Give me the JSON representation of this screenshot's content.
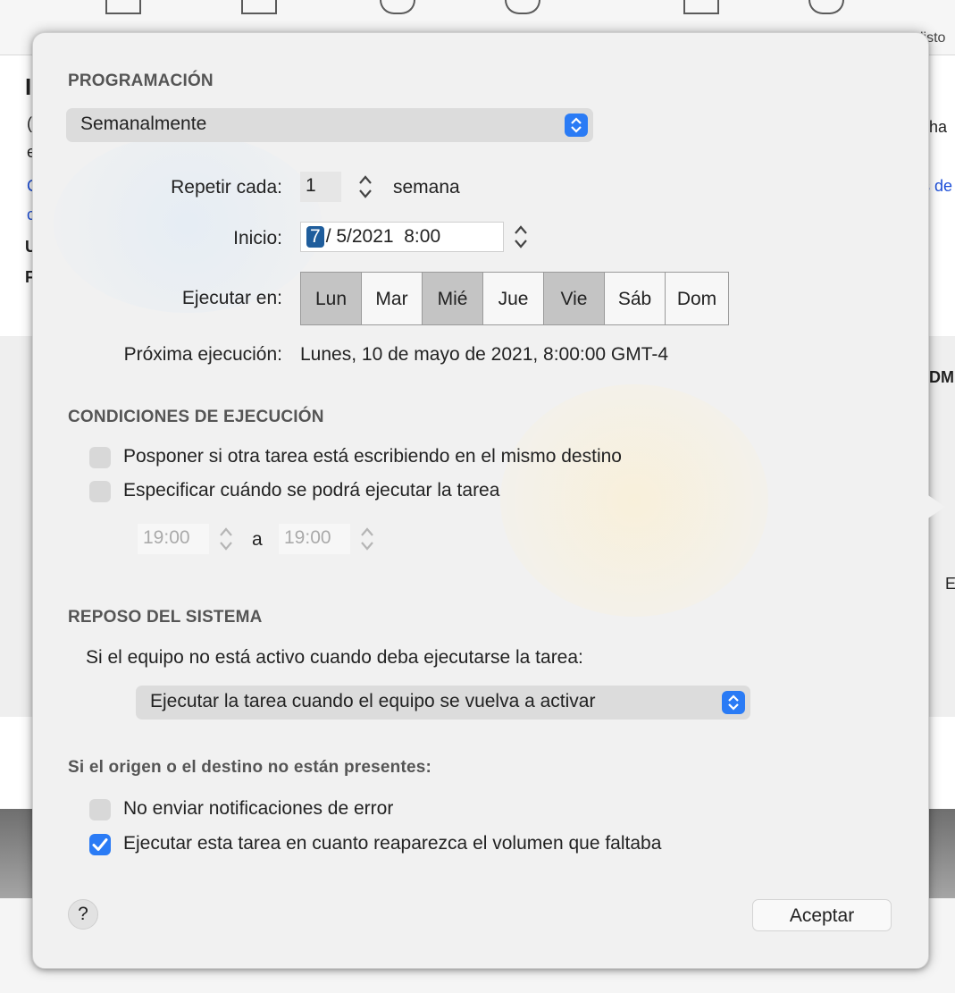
{
  "background": {
    "histo_label": "listo",
    "right_texts": [
      "ha",
      "s de",
      "DM",
      "E"
    ],
    "left_texts": [
      "I",
      "(",
      "e",
      "C",
      "c",
      "U",
      "F"
    ]
  },
  "scheduling": {
    "title": "PROGRAMACIÓN",
    "frequency": "Semanalmente",
    "repeat_label": "Repetir cada:",
    "repeat_value": "1",
    "repeat_unit": "semana",
    "start_label": "Inicio:",
    "start_day": "7",
    "start_rest": "/ 5/2021  8:00",
    "run_on_label": "Ejecutar en:",
    "days": [
      {
        "label": "Lun",
        "selected": true
      },
      {
        "label": "Mar",
        "selected": false
      },
      {
        "label": "Mié",
        "selected": true
      },
      {
        "label": "Jue",
        "selected": false
      },
      {
        "label": "Vie",
        "selected": true
      },
      {
        "label": "Sáb",
        "selected": false
      },
      {
        "label": "Dom",
        "selected": false
      }
    ],
    "next_run_label": "Próxima ejecución:",
    "next_run_value": "Lunes, 10 de mayo de 2021, 8:00:00 GMT-4"
  },
  "conditions": {
    "title": "CONDICIONES DE EJECUCIÓN",
    "postpone_label": "Posponer si otra tarea está escribiendo en el mismo destino",
    "postpone_checked": false,
    "specify_label": "Especificar cuándo se podrá ejecutar la tarea",
    "specify_checked": false,
    "from_time": "19:00",
    "to_label": "a",
    "to_time": "19:00"
  },
  "sleep": {
    "title": "REPOSO DEL SISTEMA",
    "description": "Si el equipo no está activo cuando deba ejecutarse la tarea:",
    "action": "Ejecutar la tarea cuando el equipo se vuelva a activar"
  },
  "missing": {
    "title": "Si el origen o el destino no están presentes:",
    "no_notify_label": "No enviar notificaciones de error",
    "no_notify_checked": false,
    "run_on_reappear_label": "Ejecutar esta tarea en cuanto reaparezca el volumen que faltaba",
    "run_on_reappear_checked": true
  },
  "footer": {
    "help_label": "?",
    "accept_label": "Aceptar"
  },
  "colors": {
    "accent": "#2a7bf5",
    "date_selection": "#1f5d9c",
    "popover_bg": "#f1f1f1"
  }
}
